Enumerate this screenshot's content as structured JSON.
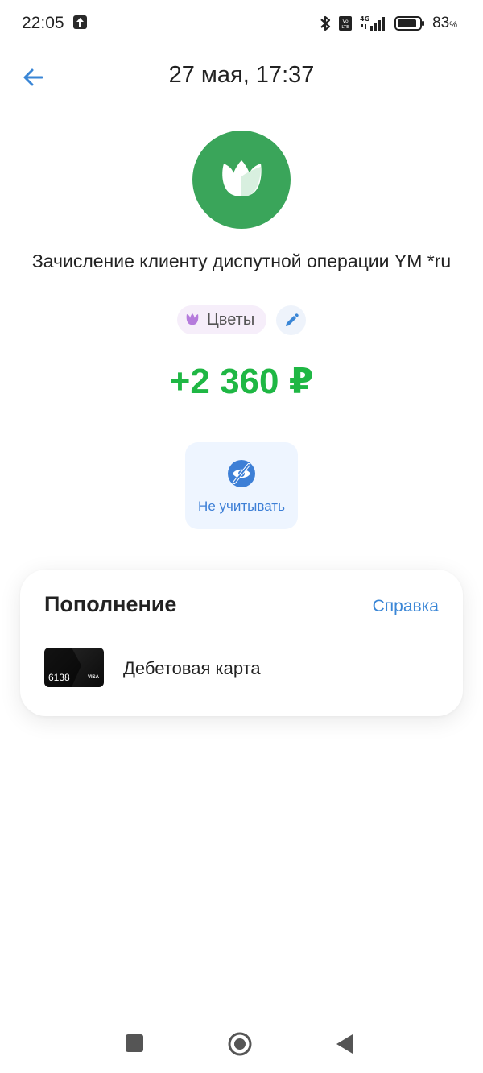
{
  "status_bar": {
    "time": "22:05",
    "battery_percent": "83",
    "battery_unit": "%",
    "network": "4G",
    "icons": [
      "upload-icon",
      "bluetooth-icon",
      "volte-icon",
      "signal-icon",
      "battery-icon"
    ]
  },
  "header": {
    "back_icon": "arrow-left-icon",
    "title": "27 мая, 17:37"
  },
  "merchant": {
    "logo_icon": "tulip-icon",
    "logo_color": "#3aa55a",
    "name": "Зачисление клиенту диспутной операции YM *ru"
  },
  "category": {
    "icon": "tulip-icon",
    "label": "Цветы",
    "edit_icon": "pencil-icon"
  },
  "amount": {
    "text": "+2 360 ₽",
    "color": "#1fb744"
  },
  "actions": {
    "ignore": {
      "icon": "eye-crossed-icon",
      "label": "Не учитывать"
    }
  },
  "details_card": {
    "title": "Пополнение",
    "help_link": "Справка",
    "card_number_tail": "6138",
    "card_brand": "VISA",
    "account_label": "Дебетовая карта"
  },
  "nav_bar": {
    "icons": [
      "recent-apps-icon",
      "home-icon",
      "back-icon"
    ]
  },
  "colors": {
    "accent_blue": "#3a86d6",
    "positive_green": "#1fb744"
  }
}
